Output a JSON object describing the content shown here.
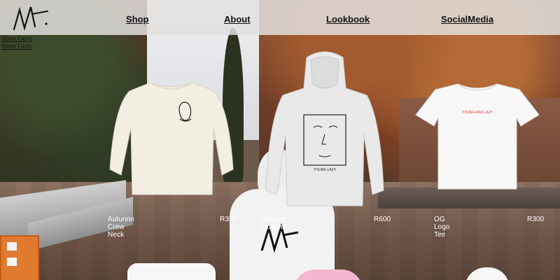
{
  "header": {
    "logo_alt": "brand signature logo",
    "nav": [
      {
        "label": "Shop"
      },
      {
        "label": "About"
      },
      {
        "label": "Lookbook"
      },
      {
        "label": "SocialMedia"
      }
    ],
    "shop_submenu": [
      {
        "label": "Shop Guys"
      },
      {
        "label": "Shop Girls"
      }
    ]
  },
  "products": [
    {
      "name": "Autunnn Crew Neck",
      "price": "R350",
      "color": "#f2efe2"
    },
    {
      "name": "Autumn Hoodie",
      "price": "R600",
      "color": "#e9e9e9"
    },
    {
      "name": "OG Logo Tee",
      "price": "R300",
      "color": "#f8f8f8",
      "print_text": "YOUNG AND LAZY",
      "print_color": "#d83a3a"
    }
  ],
  "hoodie_print_text": "YOUNG LAZY",
  "icons": [
    "signature-logo-icon"
  ]
}
